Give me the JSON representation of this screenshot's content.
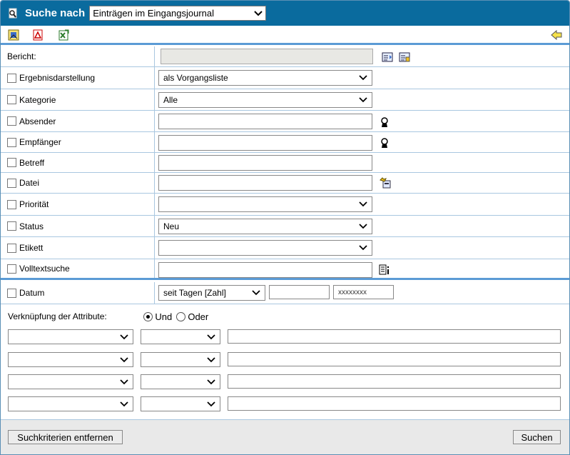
{
  "header": {
    "title": "Suche nach",
    "search_target": "Einträgen im Eingangsjournal"
  },
  "toolbar": {
    "icons": [
      "report-icon",
      "pdf-icon",
      "excel-export-icon",
      "back-arrow-icon"
    ]
  },
  "fields": {
    "bericht": {
      "label": "Bericht:",
      "value": ""
    },
    "ergebnisdarstellung": {
      "label": "Ergebnisdarstellung",
      "value": "als Vorgangsliste"
    },
    "kategorie": {
      "label": "Kategorie",
      "value": "Alle"
    },
    "absender": {
      "label": "Absender",
      "value": ""
    },
    "empfaenger": {
      "label": "Empfänger",
      "value": ""
    },
    "betreff": {
      "label": "Betreff",
      "value": ""
    },
    "datei": {
      "label": "Datei",
      "value": ""
    },
    "prioritaet": {
      "label": "Priorität",
      "value": ""
    },
    "status": {
      "label": "Status",
      "value": "Neu"
    },
    "etikett": {
      "label": "Etikett",
      "value": ""
    },
    "volltextsuche": {
      "label": "Volltextsuche",
      "value": ""
    },
    "datum": {
      "label": "Datum",
      "mode": "seit Tagen [Zahl]",
      "value": "",
      "placeholder": "xxxxxxxx"
    }
  },
  "attribute_link": {
    "label": "Verknüpfung der Attribute:",
    "options": [
      "Und",
      "Oder"
    ],
    "selected": "Und"
  },
  "criteria_rows": [
    {
      "attribute": "",
      "operator": "",
      "value": ""
    },
    {
      "attribute": "",
      "operator": "",
      "value": ""
    },
    {
      "attribute": "",
      "operator": "",
      "value": ""
    },
    {
      "attribute": "",
      "operator": "",
      "value": ""
    }
  ],
  "footer": {
    "clear_label": "Suchkriterien entfernen",
    "search_label": "Suchen"
  },
  "colors": {
    "titlebar": "#0a6b9e",
    "grid_line": "#a9c7e0",
    "separator": "#5b9bd5"
  }
}
